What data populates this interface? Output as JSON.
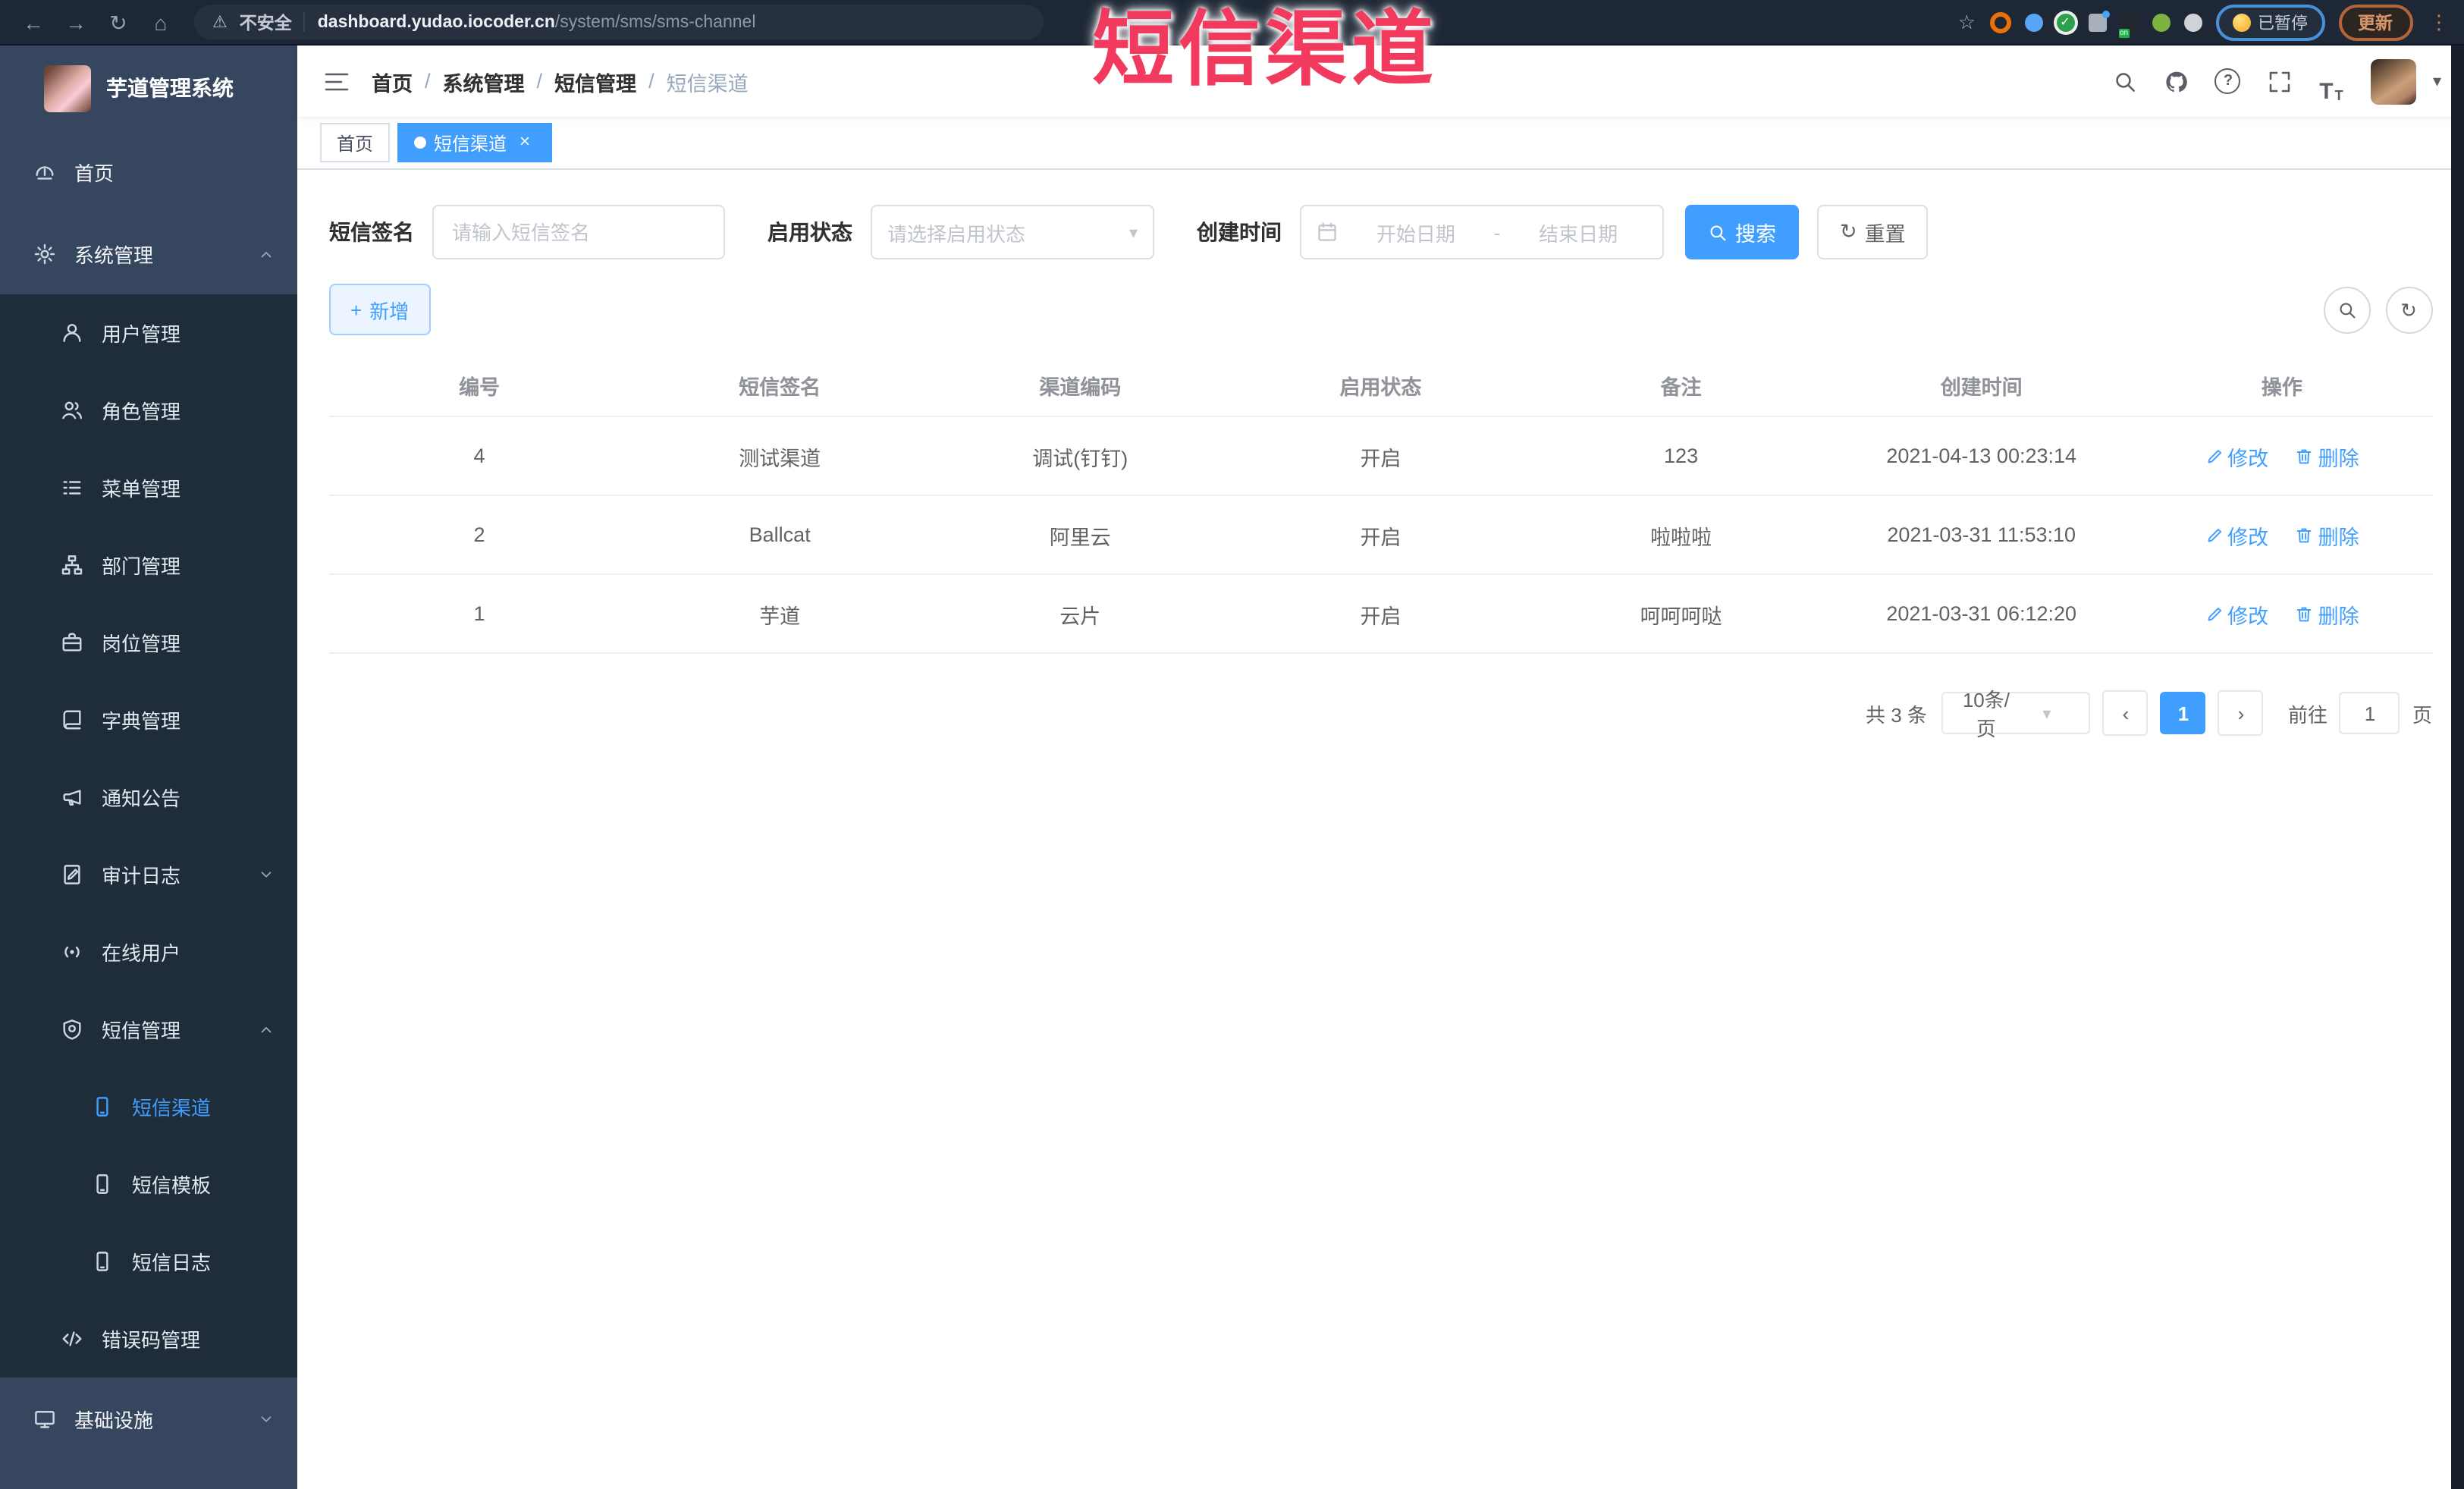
{
  "browser": {
    "security_label": "不安全",
    "url_host": "dashboard.yudao.iocoder.cn",
    "url_path": "/system/sms/sms-channel",
    "ext_badge": "on",
    "paused_label": "已暂停",
    "update_label": "更新"
  },
  "watermark": "短信渠道",
  "icons": {
    "back": "←",
    "forward": "→",
    "reload": "↻",
    "home": "⌂",
    "warning": "⚠",
    "star": "☆",
    "menu_dots": "⋮",
    "caret_down": "▾",
    "close": "×",
    "slash": "/",
    "question": "?",
    "check": "✓",
    "font_large": "T",
    "font_small": "T",
    "refresh": "↻",
    "plus": "+",
    "prev": "‹",
    "next": "›",
    "range_dash": "-"
  },
  "sidebar": {
    "app_title": "芋道管理系统",
    "items": [
      {
        "label": "首页"
      },
      {
        "label": "系统管理"
      },
      {
        "label": "用户管理"
      },
      {
        "label": "角色管理"
      },
      {
        "label": "菜单管理"
      },
      {
        "label": "部门管理"
      },
      {
        "label": "岗位管理"
      },
      {
        "label": "字典管理"
      },
      {
        "label": "通知公告"
      },
      {
        "label": "审计日志"
      },
      {
        "label": "在线用户"
      },
      {
        "label": "短信管理"
      },
      {
        "label": "短信渠道"
      },
      {
        "label": "短信模板"
      },
      {
        "label": "短信日志"
      },
      {
        "label": "错误码管理"
      },
      {
        "label": "基础设施"
      }
    ]
  },
  "header": {
    "breadcrumb": [
      "首页",
      "系统管理",
      "短信管理",
      "短信渠道"
    ]
  },
  "tabs": [
    {
      "label": "首页"
    },
    {
      "label": "短信渠道"
    }
  ],
  "filters": {
    "sign_label": "短信签名",
    "sign_placeholder": "请输入短信签名",
    "status_label": "启用状态",
    "status_placeholder": "请选择启用状态",
    "time_label": "创建时间",
    "start_placeholder": "开始日期",
    "end_placeholder": "结束日期",
    "search_label": "搜索",
    "reset_label": "重置"
  },
  "toolbar": {
    "add_label": "新增"
  },
  "table": {
    "columns": [
      "编号",
      "短信签名",
      "渠道编码",
      "启用状态",
      "备注",
      "创建时间",
      "操作"
    ],
    "rows": [
      {
        "id": "4",
        "sign": "测试渠道",
        "code": "调试(钉钉)",
        "status": "开启",
        "remark": "123",
        "created": "2021-04-13 00:23:14"
      },
      {
        "id": "2",
        "sign": "Ballcat",
        "code": "阿里云",
        "status": "开启",
        "remark": "啦啦啦",
        "created": "2021-03-31 11:53:10"
      },
      {
        "id": "1",
        "sign": "芋道",
        "code": "云片",
        "status": "开启",
        "remark": "呵呵呵哒",
        "created": "2021-03-31 06:12:20"
      }
    ],
    "edit_label": "修改",
    "delete_label": "删除"
  },
  "pagination": {
    "total_label": "共 3 条",
    "page_size": "10条/页",
    "current_page": "1",
    "goto_label": "前往",
    "goto_value": "1",
    "page_unit": "页"
  },
  "colors": {
    "accent": "#409eff",
    "sidebar_bg": "#36465f",
    "submenu_bg": "#1f2c3a",
    "watermark": "#f23a5e",
    "chrome_bg": "#1d2735"
  }
}
